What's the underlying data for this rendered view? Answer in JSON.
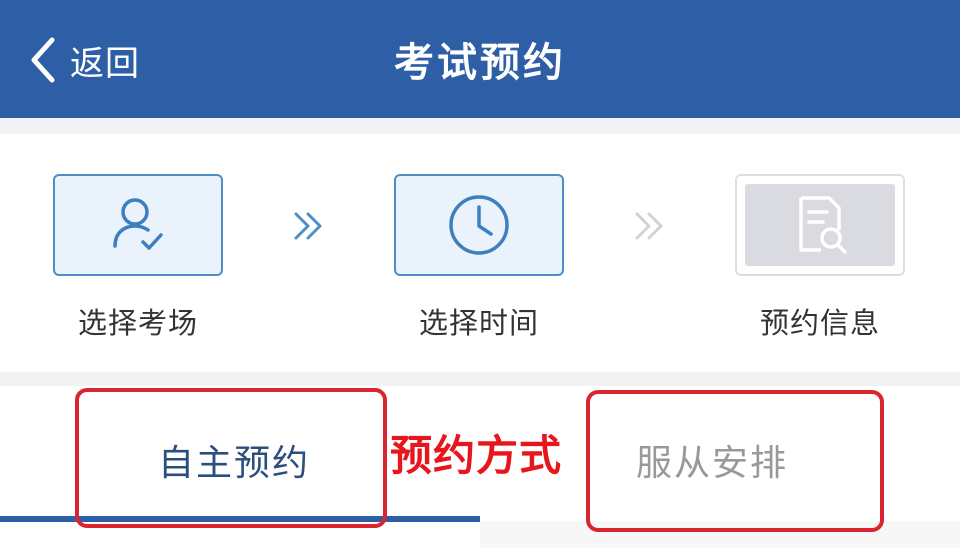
{
  "header": {
    "back_label": "返回",
    "title": "考试预约"
  },
  "steps": [
    {
      "label": "选择考场",
      "icon": "user-check-icon",
      "state": "active"
    },
    {
      "label": "选择时间",
      "icon": "clock-icon",
      "state": "active"
    },
    {
      "label": "预约信息",
      "icon": "document-search-icon",
      "state": "inactive"
    }
  ],
  "tabs": [
    {
      "label": "自主预约",
      "selected": true
    },
    {
      "label": "服从安排",
      "selected": false
    }
  ],
  "annotation": {
    "text": "预约方式",
    "color": "#e8161c"
  },
  "colors": {
    "header_bg": "#2d5ea6",
    "accent": "#4d8ec6",
    "annotation_border": "#d9262e"
  }
}
